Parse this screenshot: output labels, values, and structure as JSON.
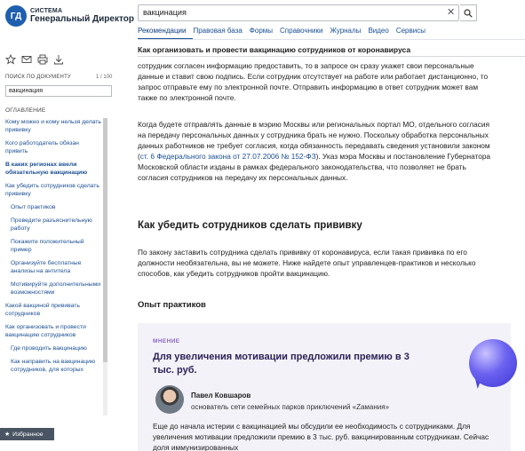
{
  "brand": {
    "logo_text": "ГД",
    "line1": "СИСТЕМА",
    "line2": "Генеральный Директор"
  },
  "search": {
    "value": "вакцинация"
  },
  "tabs": [
    {
      "label": "Рекомендации",
      "active": true
    },
    {
      "label": "Правовая база"
    },
    {
      "label": "Формы"
    },
    {
      "label": "Справочники"
    },
    {
      "label": "Журналы"
    },
    {
      "label": "Видео"
    },
    {
      "label": "Сервисы"
    }
  ],
  "document_title": "Как организовать и провести вакцинацию сотрудников от коронавируса",
  "left_panel": {
    "search_label": "ПОИСК ПО ДОКУМЕНТУ",
    "search_count": "1 / 100",
    "search_value": "вакцинация",
    "toc_title": "ОГЛАВЛЕНИЕ",
    "toc_items": [
      {
        "label": "Кому можно и кому нельзя делать прививку"
      },
      {
        "label": "Кого работодатель обязан привить"
      },
      {
        "label": "В каких регионах ввели обязательную вакцинацию",
        "active": true
      },
      {
        "label": "Как убедить сотрудников сделать прививку"
      },
      {
        "label": "Опыт практиков",
        "sub": true
      },
      {
        "label": "Проведите разъяснительную работу",
        "sub": true
      },
      {
        "label": "Покажите положительный пример",
        "sub": true
      },
      {
        "label": "Организуйте бесплатные анализы на антитела",
        "sub": true
      },
      {
        "label": "Мотивируйте дополнительными возможностями",
        "sub": true
      },
      {
        "label": "Какой вакциной прививать сотрудников"
      },
      {
        "label": "Как организовать и провести вакцинацию сотрудников"
      },
      {
        "label": "Где проводить вакцинацию",
        "sub": true
      },
      {
        "label": "Как направить на вакцинацию сотрудников, для которых",
        "sub": true
      }
    ],
    "favorites_label": "Избранное"
  },
  "content": {
    "para1": "сотрудник согласен информацию предоставить, то в запросе он сразу укажет свои персональные данные и ставит свою подпись. Если сотрудник отсутствует на работе или работает дистанционно, то запрос отправьте ему по электронной почте. Отправить информацию в ответ сотрудник может вам также по электронной почте.",
    "para2_before": "Когда будете отправлять данные в мэрию Москвы или региональных портал МО, отдельного согласия на передачу персональных данных у сотрудника брать не нужно. Поскольку обработка персональных данных работников не требует согласия, когда обязанность передавать сведения установили законом (",
    "para2_link": "ст. 6 Федерального закона от 27.07.2006 № 152-ФЗ",
    "para2_after": "). Указ мэра Москвы и постановление Губернатора Московской области изданы в рамках федерального законодательства, что позволяет не брать согласия сотрудников на передачу их персональных данных.",
    "heading": "Как убедить сотрудников сделать прививку",
    "para3": "По закону заставить сотрудника сделать прививку от коронавируса, если такая прививка по его должности необязательна, вы не можете. Ниже найдете опыт управленцев-практиков и несколько способов, как убедить сотрудников пройти вакцинацию.",
    "subheading": "Опыт практиков",
    "card": {
      "tag": "МНЕНИЕ",
      "title": "Для увеличения мотивации предложили премию в 3 тыс. руб.",
      "person_name": "Павел Ковшаров",
      "person_role": "основатель сети семейных парков приключений «Zамания»",
      "text": "Еще до начала истерии с вакцинацией мы обсудили ее необходимость с сотрудниками. Для увеличения мотивации предложили премию в 3 тыс. руб. вакцинированным сотрудникам. Сейчас доля иммунизированных"
    }
  },
  "colors": {
    "accent": "#1a4f93",
    "logo": "#1f5fae",
    "card_bg": "#f3f2f8",
    "card_tag": "#8c68c2"
  },
  "icons": [
    "star-icon",
    "mail-icon",
    "print-icon",
    "download-icon",
    "search-icon",
    "close-icon",
    "star-small-icon",
    "chat-bubble-icon"
  ]
}
